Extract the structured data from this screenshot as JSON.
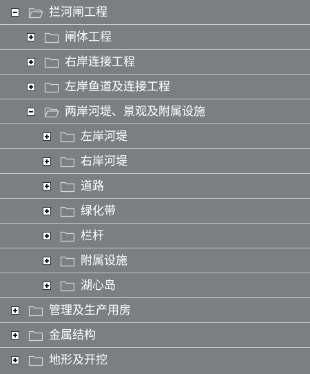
{
  "tree": {
    "nodes": [
      {
        "label": "拦河闸工程",
        "level": 0,
        "expanded": true,
        "icon": "folder-open-icon"
      },
      {
        "label": "闸体工程",
        "level": 1,
        "expanded": false,
        "icon": "folder-icon"
      },
      {
        "label": "右岸连接工程",
        "level": 1,
        "expanded": false,
        "icon": "folder-icon"
      },
      {
        "label": "左岸鱼道及连接工程",
        "level": 1,
        "expanded": false,
        "icon": "folder-icon"
      },
      {
        "label": "两岸河堤、景观及附属设施",
        "level": 1,
        "expanded": true,
        "icon": "folder-open-icon"
      },
      {
        "label": "左岸河堤",
        "level": 2,
        "expanded": false,
        "icon": "folder-icon"
      },
      {
        "label": "右岸河堤",
        "level": 2,
        "expanded": false,
        "icon": "folder-icon"
      },
      {
        "label": "道路",
        "level": 2,
        "expanded": false,
        "icon": "folder-icon"
      },
      {
        "label": "绿化带",
        "level": 2,
        "expanded": false,
        "icon": "folder-icon"
      },
      {
        "label": "栏杆",
        "level": 2,
        "expanded": false,
        "icon": "folder-icon"
      },
      {
        "label": "附属设施",
        "level": 2,
        "expanded": false,
        "icon": "folder-icon"
      },
      {
        "label": "湖心岛",
        "level": 2,
        "expanded": false,
        "icon": "folder-icon"
      },
      {
        "label": "管理及生产用房",
        "level": 0,
        "expanded": false,
        "icon": "folder-icon"
      },
      {
        "label": "金属结构",
        "level": 0,
        "expanded": false,
        "icon": "folder-icon"
      },
      {
        "label": "地形及开挖",
        "level": 0,
        "expanded": false,
        "icon": "folder-icon"
      }
    ]
  },
  "colors": {
    "background": "#7b7f82",
    "separator": "#c9cbcc",
    "text": "#ffffff",
    "folder_stroke": "#d6d6d6"
  }
}
